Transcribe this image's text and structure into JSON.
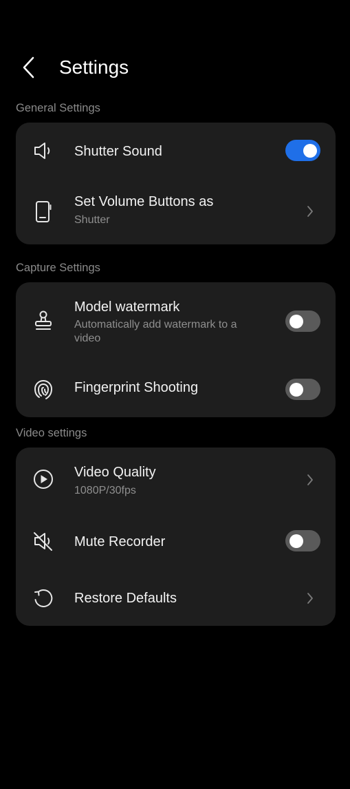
{
  "header": {
    "title": "Settings",
    "back_icon": "chevron-left-icon"
  },
  "sections": {
    "general": {
      "label": "General Settings",
      "shutter_sound": {
        "title": "Shutter Sound",
        "icon": "speaker-icon",
        "toggle_on": true
      },
      "volume_buttons": {
        "title": "Set Volume Buttons as",
        "subtitle": "Shutter",
        "icon": "phone-volume-icon"
      }
    },
    "capture": {
      "label": "Capture Settings",
      "model_watermark": {
        "title": "Model watermark",
        "subtitle": "Automatically add watermark to a video",
        "icon": "stamp-icon",
        "toggle_on": false
      },
      "fingerprint": {
        "title": "Fingerprint Shooting",
        "icon": "fingerprint-icon",
        "toggle_on": false
      }
    },
    "video": {
      "label": "Video settings",
      "video_quality": {
        "title": "Video Quality",
        "subtitle": "1080P/30fps",
        "icon": "play-circle-icon"
      },
      "mute_recorder": {
        "title": "Mute Recorder",
        "icon": "speaker-muted-icon",
        "toggle_on": false
      },
      "restore_defaults": {
        "title": "Restore Defaults",
        "icon": "restore-icon"
      }
    }
  },
  "colors": {
    "background": "#000000",
    "card": "#1e1e1e",
    "accent": "#1f6fe8",
    "toggle_off": "#5a5a5a",
    "secondary_text": "#8f8f8f"
  }
}
